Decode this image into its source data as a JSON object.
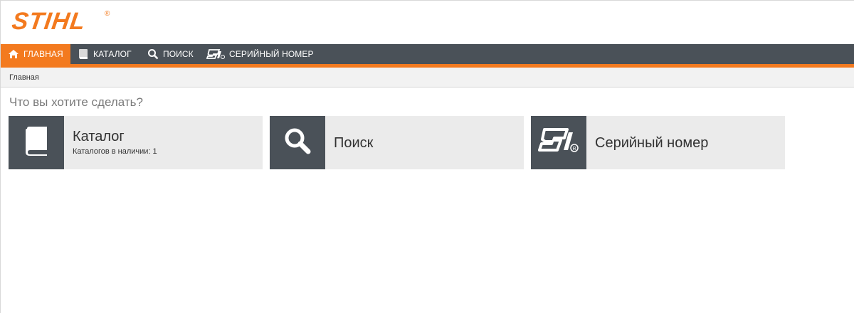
{
  "brand": {
    "logo_text": "STIHL",
    "registered": "®"
  },
  "nav": {
    "items": [
      {
        "label": "ГЛАВНАЯ",
        "icon": "home-icon",
        "active": true
      },
      {
        "label": "КАТАЛОГ",
        "icon": "book-icon",
        "active": false
      },
      {
        "label": "ПОИСК",
        "icon": "search-icon",
        "active": false
      },
      {
        "label": "СЕРИЙНЫЙ НОМЕР",
        "icon": "serial-number-icon",
        "active": false
      }
    ]
  },
  "breadcrumb": {
    "current": "Главная"
  },
  "main": {
    "question": "Что вы хотите сделать?",
    "tiles": [
      {
        "title": "Каталог",
        "subtitle": "Каталогов в наличии: 1",
        "icon": "book-icon"
      },
      {
        "title": "Поиск",
        "icon": "search-icon"
      },
      {
        "title": "Серийный номер",
        "icon": "serial-number-icon"
      }
    ]
  },
  "colors": {
    "accent": "#f37a1f",
    "nav_bg": "#4a5158",
    "tile_bg": "#ebebeb"
  }
}
